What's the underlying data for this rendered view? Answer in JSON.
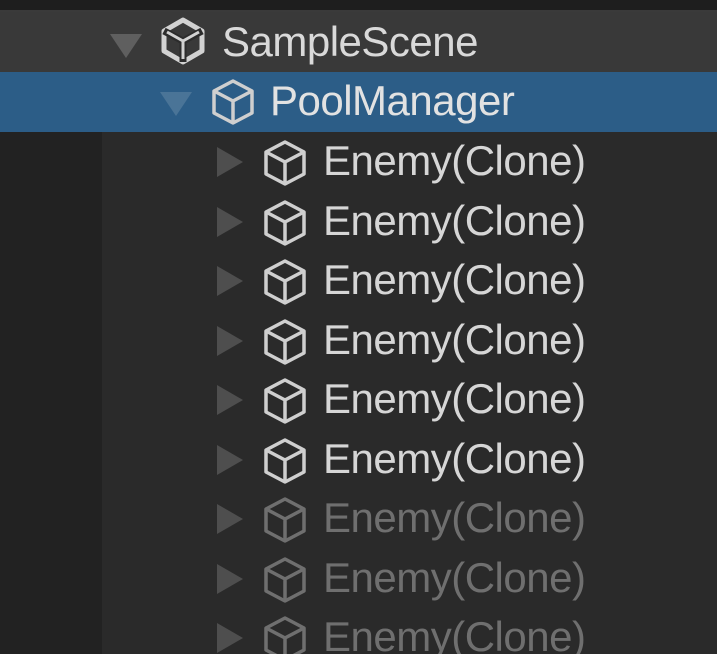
{
  "hierarchy": {
    "scene": {
      "name": "SampleScene",
      "icon": "unity-scene-icon"
    },
    "root": {
      "name": "PoolManager",
      "icon": "cube-icon",
      "selected": true
    },
    "children": [
      {
        "name": "Enemy(Clone)",
        "active": true
      },
      {
        "name": "Enemy(Clone)",
        "active": true
      },
      {
        "name": "Enemy(Clone)",
        "active": true
      },
      {
        "name": "Enemy(Clone)",
        "active": true
      },
      {
        "name": "Enemy(Clone)",
        "active": true
      },
      {
        "name": "Enemy(Clone)",
        "active": true
      },
      {
        "name": "Enemy(Clone)",
        "active": false
      },
      {
        "name": "Enemy(Clone)",
        "active": false
      },
      {
        "name": "Enemy(Clone)",
        "active": false
      }
    ]
  },
  "colors": {
    "selection": "#2c5d87",
    "background": "#2a2a2a",
    "text": "#d6d6d6",
    "inactive_text": "#6f6f6f"
  }
}
